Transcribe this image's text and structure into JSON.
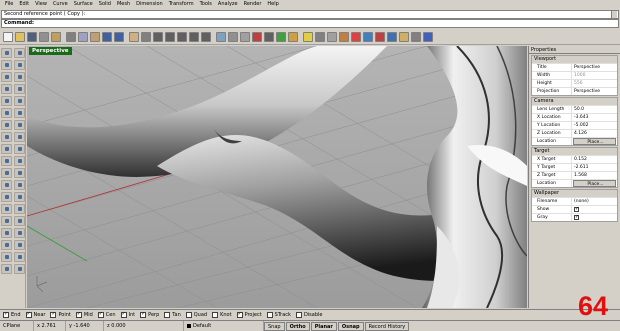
{
  "menu": [
    "File",
    "Edit",
    "View",
    "Curve",
    "Surface",
    "Solid",
    "Mesh",
    "Dimension",
    "Transform",
    "Tools",
    "Analyze",
    "Render",
    "Help"
  ],
  "command": {
    "history": "Second reference point ( Copy ):",
    "prompt": "Command:"
  },
  "toolbar_icons": [
    {
      "name": "new-icon",
      "color": "#f4f4f4"
    },
    {
      "name": "open-icon",
      "color": "#e0c060"
    },
    {
      "name": "save-icon",
      "color": "#506080"
    },
    {
      "name": "print-icon",
      "color": "#909090"
    },
    {
      "name": "import-icon",
      "color": "#c0a060"
    },
    {
      "name": "cut-icon",
      "color": "#808080"
    },
    {
      "name": "copy-icon",
      "color": "#a0a0c0"
    },
    {
      "name": "paste-icon",
      "color": "#c0a070"
    },
    {
      "name": "undo-icon",
      "color": "#4060a0"
    },
    {
      "name": "redo-icon",
      "color": "#4060a0"
    },
    {
      "name": "pan-icon",
      "color": "#d0b080"
    },
    {
      "name": "rotate-view-icon",
      "color": "#808080"
    },
    {
      "name": "zoom-icon",
      "color": "#606060"
    },
    {
      "name": "zoom-window-icon",
      "color": "#606060"
    },
    {
      "name": "zoom-extents-icon",
      "color": "#606060"
    },
    {
      "name": "zoom-selected-icon",
      "color": "#606060"
    },
    {
      "name": "zoom-all-icon",
      "color": "#606060"
    },
    {
      "name": "four-views-icon",
      "color": "#80a0c0"
    },
    {
      "name": "cplane-icon",
      "color": "#909090"
    },
    {
      "name": "grid-icon",
      "color": "#a0a0a0"
    },
    {
      "name": "layer-icon",
      "color": "#c04040"
    },
    {
      "name": "select-icon",
      "color": "#606060"
    },
    {
      "name": "hide-icon",
      "color": "#40a040"
    },
    {
      "name": "lock-icon",
      "color": "#d0a040"
    },
    {
      "name": "light-icon",
      "color": "#e0d040"
    },
    {
      "name": "wireframe-icon",
      "color": "#808080"
    },
    {
      "name": "shaded-icon",
      "color": "#a0a0a0"
    },
    {
      "name": "rendered-icon",
      "color": "#c08040"
    },
    {
      "name": "color-wheel-icon",
      "color": "#e04040"
    },
    {
      "name": "material-icon",
      "color": "#4080c0"
    },
    {
      "name": "render-icon",
      "color": "#c04040"
    },
    {
      "name": "environment-icon",
      "color": "#4070b0"
    },
    {
      "name": "properties-icon",
      "color": "#d0b060"
    },
    {
      "name": "options-icon",
      "color": "#808080"
    },
    {
      "name": "help-icon",
      "color": "#4060c0"
    }
  ],
  "viewport": {
    "title": "Perspective"
  },
  "properties": {
    "title": "Properties",
    "viewport_section": {
      "heading": "Viewport",
      "rows": [
        {
          "label": "Title",
          "value": "Perspective",
          "grey": false
        },
        {
          "label": "Width",
          "value": "1000",
          "grey": true
        },
        {
          "label": "Height",
          "value": "556",
          "grey": true
        },
        {
          "label": "Projection",
          "value": "Perspective",
          "grey": false
        }
      ]
    },
    "camera_section": {
      "heading": "Camera",
      "rows": [
        {
          "label": "Lens Length",
          "value": "50.0"
        },
        {
          "label": "X Location",
          "value": "-3.643"
        },
        {
          "label": "Y Location",
          "value": "-5.002"
        },
        {
          "label": "Z Location",
          "value": "4.126"
        }
      ],
      "location_label": "Location",
      "location_button": "Place..."
    },
    "target_section": {
      "heading": "Target",
      "rows": [
        {
          "label": "X Target",
          "value": "0.152"
        },
        {
          "label": "Y Target",
          "value": "-2.611"
        },
        {
          "label": "Z Target",
          "value": "1.568"
        }
      ],
      "location_label": "Location",
      "location_button": "Place..."
    },
    "wallpaper_section": {
      "heading": "Wallpaper",
      "filename_label": "Filename",
      "filename_value": "(none)",
      "show_label": "Show",
      "gray_label": "Gray"
    }
  },
  "osnap": [
    {
      "label": "End",
      "checked": true
    },
    {
      "label": "Near",
      "checked": true
    },
    {
      "label": "Point",
      "checked": true
    },
    {
      "label": "Mid",
      "checked": true
    },
    {
      "label": "Cen",
      "checked": true
    },
    {
      "label": "Int",
      "checked": true
    },
    {
      "label": "Perp",
      "checked": true
    },
    {
      "label": "Tan",
      "checked": false
    },
    {
      "label": "Quad",
      "checked": false
    },
    {
      "label": "Knot",
      "checked": false
    },
    {
      "label": "Project",
      "checked": true
    },
    {
      "label": "STrack",
      "checked": false
    },
    {
      "label": "Disable",
      "checked": false
    }
  ],
  "status": {
    "cplane": "CPlane",
    "x": "x 2.761",
    "y": "y -1.640",
    "z": "z 0.000",
    "layer": "Default",
    "snap": "Snap",
    "ortho": "Ortho",
    "planar": "Planar",
    "osnap": "Osnap",
    "record_history": "Record History"
  },
  "overlay_number": "64"
}
